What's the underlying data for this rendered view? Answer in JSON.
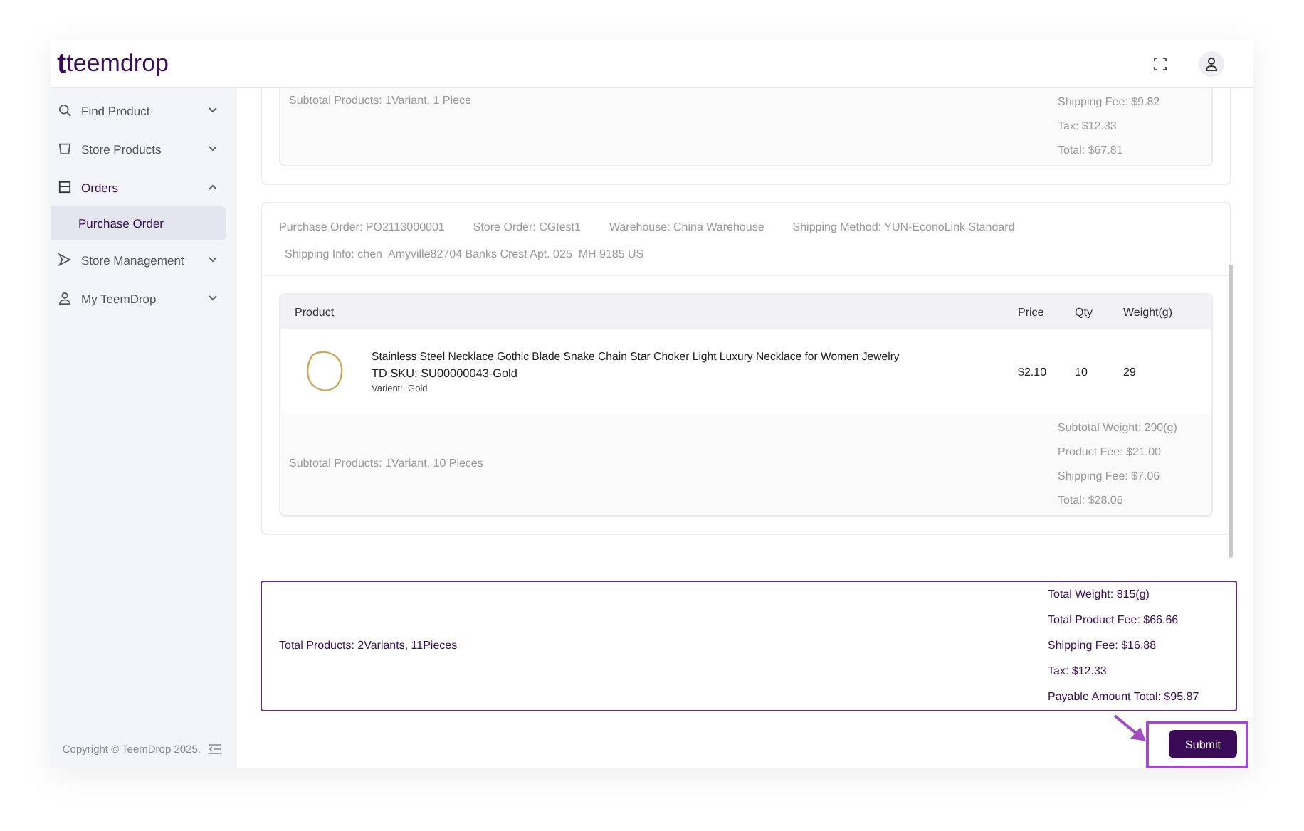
{
  "header": {
    "logo_mark": "t",
    "logo_text": "teemdrop"
  },
  "sidebar": {
    "items": [
      {
        "label": "Find Product",
        "expanded": false
      },
      {
        "label": "Store Products",
        "expanded": false
      },
      {
        "label": "Orders",
        "expanded": true,
        "children": [
          {
            "label": "Purchase Order",
            "selected": true
          }
        ]
      },
      {
        "label": "Store Management",
        "expanded": false
      },
      {
        "label": "My TeemDrop",
        "expanded": false
      }
    ],
    "copyright": "Copyright © TeemDrop 2025."
  },
  "orders": [
    {
      "subtotal_products": "Subtotal Products: 1Variant, 1 Piece",
      "subtotals": [
        "Shipping Fee: $9.82",
        "Tax: $12.33",
        "Total: $67.81"
      ]
    },
    {
      "info": [
        "Purchase Order: PO2113000001",
        "Store Order: CGtest1",
        "Warehouse: China Warehouse",
        "Shipping Method: YUN-EconoLink Standard"
      ],
      "shipping_info": "Shipping Info: chen  Amyville82704 Banks Crest Apt. 025  MH 9185 US",
      "columns": [
        "Product",
        "Price",
        "Qty",
        "Weight(g)"
      ],
      "rows": [
        {
          "title": "Stainless Steel Necklace Gothic Blade Snake Chain Star Choker Light Luxury Necklace for Women Jewelry",
          "sku": "TD SKU: SU00000043-Gold",
          "variant_label": "Varient:",
          "variant": "Gold",
          "price": "$2.10",
          "qty": "10",
          "weight": "29"
        }
      ],
      "subtotal_products": "Subtotal Products: 1Variant, 10 Pieces",
      "subtotals": [
        "Subtotal Weight: 290(g)",
        "Product Fee: $21.00",
        "Shipping Fee: $7.06",
        "Total: $28.06"
      ]
    }
  ],
  "summary": {
    "total_products": "Total Products: 2Variants, 11Pieces",
    "lines": [
      "Total Weight: 815(g)",
      "Total Product Fee: $66.66",
      "Shipping Fee: $16.88",
      "Tax: $12.33",
      "Payable Amount Total: $95.87"
    ]
  },
  "submit": {
    "label": "Submit"
  }
}
